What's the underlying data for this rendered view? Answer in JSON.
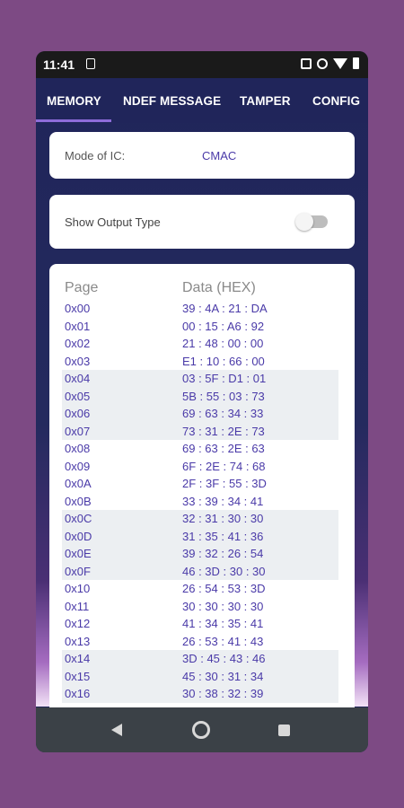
{
  "status_bar": {
    "time": "11:41"
  },
  "tabs": [
    {
      "label": "MEMORY"
    },
    {
      "label": "NDEF MESSAGE"
    },
    {
      "label": "TAMPER"
    },
    {
      "label": "CONFIG"
    }
  ],
  "mode_card": {
    "label": "Mode of IC:",
    "value": "CMAC"
  },
  "output_toggle": {
    "label": "Show Output Type",
    "state": "off"
  },
  "memory_table": {
    "headers": {
      "page": "Page",
      "data": "Data (HEX)"
    },
    "rows": [
      {
        "page": "0x00",
        "data": "39 : 4A : 21 : DA"
      },
      {
        "page": "0x01",
        "data": "00 : 15 : A6 : 92"
      },
      {
        "page": "0x02",
        "data": "21 : 48 : 00 : 00"
      },
      {
        "page": "0x03",
        "data": "E1 : 10 : 66 : 00"
      },
      {
        "page": "0x04",
        "data": "03 : 5F : D1 : 01"
      },
      {
        "page": "0x05",
        "data": "5B : 55 : 03 : 73"
      },
      {
        "page": "0x06",
        "data": "69 : 63 : 34 : 33"
      },
      {
        "page": "0x07",
        "data": "73 : 31 : 2E : 73"
      },
      {
        "page": "0x08",
        "data": "69 : 63 : 2E : 63"
      },
      {
        "page": "0x09",
        "data": "6F : 2E : 74 : 68"
      },
      {
        "page": "0x0A",
        "data": "2F : 3F : 55 : 3D"
      },
      {
        "page": "0x0B",
        "data": "33 : 39 : 34 : 41"
      },
      {
        "page": "0x0C",
        "data": "32 : 31 : 30 : 30"
      },
      {
        "page": "0x0D",
        "data": "31 : 35 : 41 : 36"
      },
      {
        "page": "0x0E",
        "data": "39 : 32 : 26 : 54"
      },
      {
        "page": "0x0F",
        "data": "46 : 3D : 30 : 30"
      },
      {
        "page": "0x10",
        "data": "26 : 54 : 53 : 3D"
      },
      {
        "page": "0x11",
        "data": "30 : 30 : 30 : 30"
      },
      {
        "page": "0x12",
        "data": "41 : 34 : 35 : 41"
      },
      {
        "page": "0x13",
        "data": "26 : 53 : 41 : 43"
      },
      {
        "page": "0x14",
        "data": "3D : 45 : 43 : 46"
      },
      {
        "page": "0x15",
        "data": "45 : 30 : 31 : 34"
      },
      {
        "page": "0x16",
        "data": "30 : 38 : 32 : 39"
      }
    ]
  },
  "colors": {
    "background": "#7d4a84",
    "app_bar": "#20255a",
    "accent": "#8e6cd9",
    "value_text": "#4a3aa8",
    "row_shade": "#eceff2"
  },
  "icons": {
    "status": [
      "sim-icon",
      "nfc-icon",
      "vibrate-icon",
      "wifi-icon",
      "battery-icon"
    ],
    "nav": [
      "back-icon",
      "home-icon",
      "recents-icon"
    ]
  }
}
